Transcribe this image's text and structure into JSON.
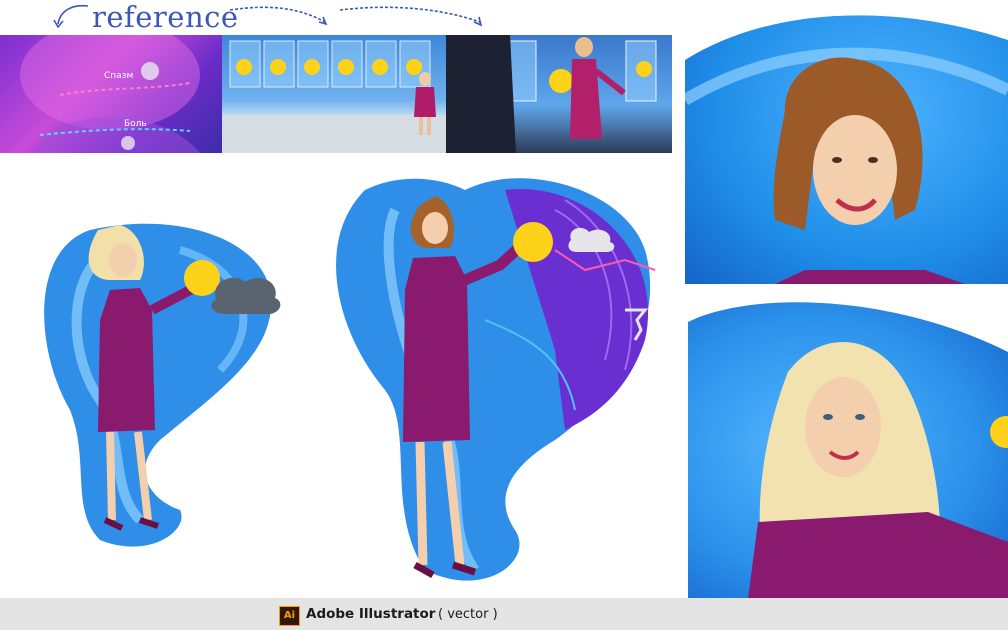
{
  "header": {
    "reference_label": "reference"
  },
  "reference_panels": [
    {
      "words": [
        "Спазм",
        "Боль"
      ]
    },
    {
      "words": []
    },
    {
      "words": []
    }
  ],
  "footer": {
    "app_icon_text": "Ai",
    "app_name": "Adobe Illustrator",
    "format_note": "( vector )"
  },
  "colors": {
    "label_blue": "#3b57b8",
    "footer_bg": "#e4e4e4",
    "dress_purple": "#8a1a6e",
    "wave_blue": "#2f8ee8",
    "ai_orange": "#ff9a00"
  },
  "icons": [
    "arrow-curve-icon",
    "sun-icon",
    "cloud-icon",
    "tornado-icon",
    "adobe-illustrator-icon"
  ]
}
